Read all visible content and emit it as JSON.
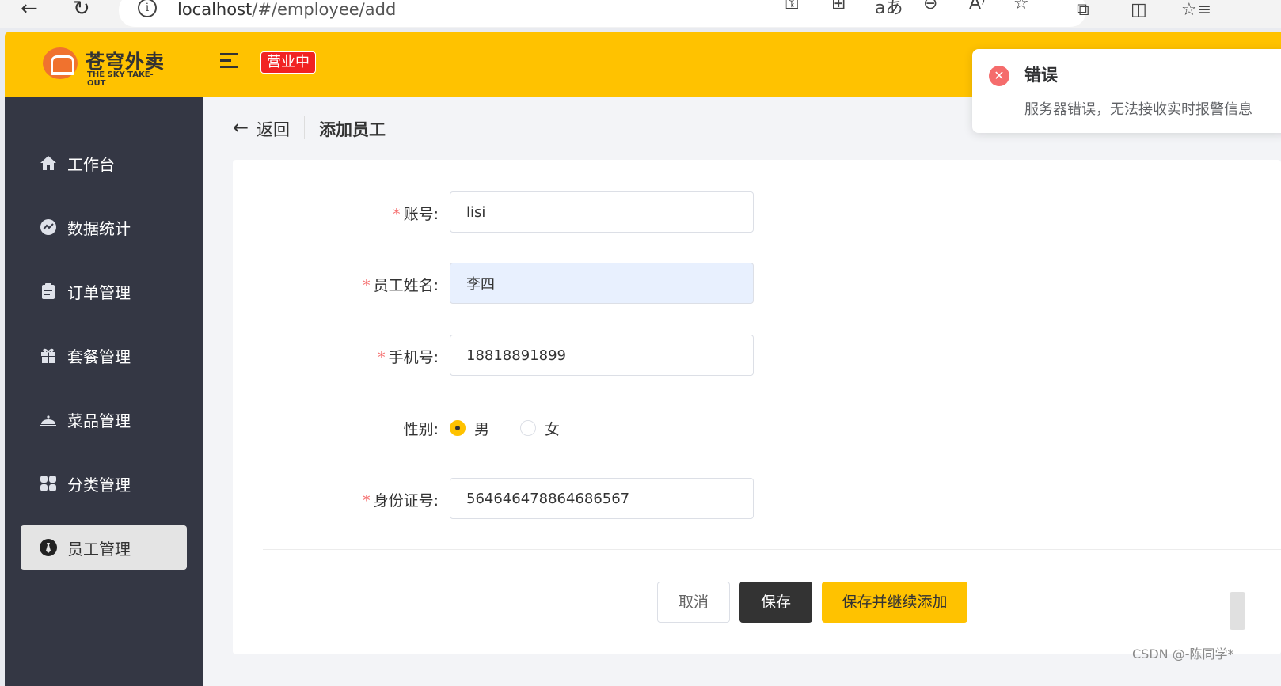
{
  "browser": {
    "url_host": "localhost",
    "url_path": "/#/employee/add"
  },
  "header": {
    "logo_cn": "苍穹外卖",
    "logo_en": "THE SKY TAKE-OUT",
    "status_tag": "营业中",
    "accent_color": "#ffc200"
  },
  "sidebar": {
    "items": [
      {
        "label": "工作台",
        "icon": "home-icon"
      },
      {
        "label": "数据统计",
        "icon": "chart-icon"
      },
      {
        "label": "订单管理",
        "icon": "clipboard-icon"
      },
      {
        "label": "套餐管理",
        "icon": "gift-icon"
      },
      {
        "label": "菜品管理",
        "icon": "cloche-icon"
      },
      {
        "label": "分类管理",
        "icon": "grid-icon"
      },
      {
        "label": "员工管理",
        "icon": "tie-icon",
        "active": true
      }
    ]
  },
  "breadcrumb": {
    "back_label": "返回",
    "page_title": "添加员工"
  },
  "form": {
    "username": {
      "label": "账号:",
      "value": "lisi"
    },
    "name": {
      "label": "员工姓名:",
      "value": "李四"
    },
    "phone": {
      "label": "手机号:",
      "value": "18818891899"
    },
    "gender": {
      "label": "性别:",
      "options": [
        "男",
        "女"
      ],
      "selected": "男"
    },
    "id_number": {
      "label": "身份证号:",
      "value": "564646478864686567"
    }
  },
  "buttons": {
    "cancel": "取消",
    "save": "保存",
    "save_and_continue": "保存并继续添加"
  },
  "notification": {
    "title": "错误",
    "message": "服务器错误，无法接收实时报警信息"
  },
  "watermark": "CSDN @-陈同学*"
}
